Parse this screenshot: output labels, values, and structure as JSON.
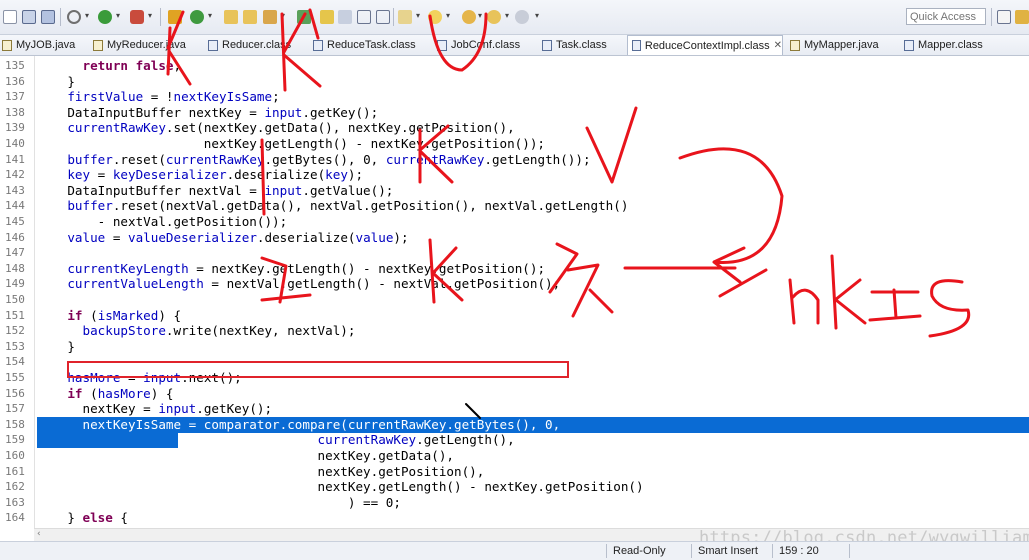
{
  "toolbar": {
    "quick_access_placeholder": "Quick Access"
  },
  "tabs": [
    {
      "label": "MyJOB.java",
      "kind": "java",
      "active": false
    },
    {
      "label": "MyReducer.java",
      "kind": "java",
      "active": false
    },
    {
      "label": "Reducer.class",
      "kind": "class",
      "active": false
    },
    {
      "label": "ReduceTask.class",
      "kind": "class",
      "active": false
    },
    {
      "label": "JobConf.class",
      "kind": "class",
      "active": false
    },
    {
      "label": "Task.class",
      "kind": "class",
      "active": false
    },
    {
      "label": "ReduceContextImpl.class",
      "kind": "class",
      "active": true,
      "close": "✕"
    },
    {
      "label": "MyMapper.java",
      "kind": "java",
      "active": false
    },
    {
      "label": "Mapper.class",
      "kind": "class",
      "active": false
    }
  ],
  "editor": {
    "lines": [
      {
        "num": "135",
        "text": "      return false;"
      },
      {
        "num": "136",
        "text": "    }"
      },
      {
        "num": "137",
        "text": "    firstValue = !nextKeyIsSame;"
      },
      {
        "num": "138",
        "text": "    DataInputBuffer nextKey = input.getKey();"
      },
      {
        "num": "139",
        "text": "    currentRawKey.set(nextKey.getData(), nextKey.getPosition(),"
      },
      {
        "num": "140",
        "text": "                      nextKey.getLength() - nextKey.getPosition());"
      },
      {
        "num": "141",
        "text": "    buffer.reset(currentRawKey.getBytes(), 0, currentRawKey.getLength());"
      },
      {
        "num": "142",
        "text": "    key = keyDeserializer.deserialize(key);"
      },
      {
        "num": "143",
        "text": "    DataInputBuffer nextVal = input.getValue();"
      },
      {
        "num": "144",
        "text": "    buffer.reset(nextVal.getData(), nextVal.getPosition(), nextVal.getLength()"
      },
      {
        "num": "145",
        "text": "        - nextVal.getPosition());"
      },
      {
        "num": "146",
        "text": "    value = valueDeserializer.deserialize(value);"
      },
      {
        "num": "147",
        "text": ""
      },
      {
        "num": "148",
        "text": "    currentKeyLength = nextKey.getLength() - nextKey.getPosition();"
      },
      {
        "num": "149",
        "text": "    currentValueLength = nextVal.getLength() - nextVal.getPosition();"
      },
      {
        "num": "150",
        "text": ""
      },
      {
        "num": "151",
        "text": "    if (isMarked) {"
      },
      {
        "num": "152",
        "text": "      backupStore.write(nextKey, nextVal);"
      },
      {
        "num": "153",
        "text": "    }"
      },
      {
        "num": "154",
        "text": ""
      },
      {
        "num": "155",
        "text": "    hasMore = input.next();"
      },
      {
        "num": "156",
        "text": "    if (hasMore) {"
      },
      {
        "num": "157",
        "text": "      nextKey = input.getKey();"
      },
      {
        "num": "158",
        "text": "      nextKeyIsSame = comparator.compare(currentRawKey.getBytes(), 0,"
      },
      {
        "num": "159",
        "text": "                                     currentRawKey.getLength(),"
      },
      {
        "num": "160",
        "text": "                                     nextKey.getData(),"
      },
      {
        "num": "161",
        "text": "                                     nextKey.getPosition(),"
      },
      {
        "num": "162",
        "text": "                                     nextKey.getLength() - nextKey.getPosition()"
      },
      {
        "num": "163",
        "text": "                                         ) == 0;"
      },
      {
        "num": "164",
        "text": "    } else {"
      }
    ],
    "selected_line": "158"
  },
  "handwriting": {
    "color": "#e8141c",
    "labels": [
      "K",
      "V",
      "K",
      "V",
      "1",
      "K",
      "1",
      "K",
      "V",
      "nkIS"
    ]
  },
  "status": {
    "mode": "Read-Only",
    "insert": "Smart Insert",
    "position": "159 : 20"
  },
  "watermark": "https://blog.csdn.net/wyqwilliam"
}
